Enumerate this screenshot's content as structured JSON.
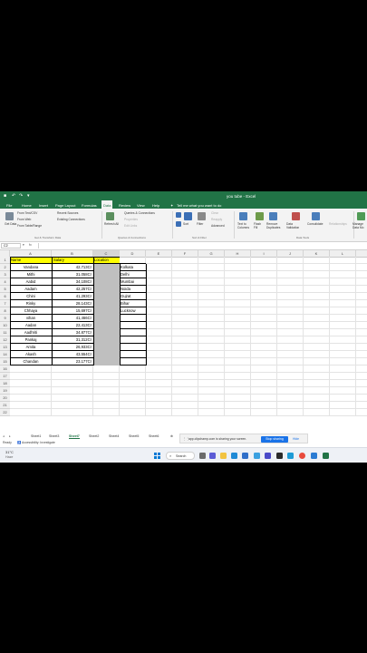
{
  "window": {
    "title": "you tube - Excel"
  },
  "menu": {
    "tabs": [
      "File",
      "Home",
      "Insert",
      "Page Layout",
      "Formulas",
      "Data",
      "Review",
      "View",
      "Help"
    ],
    "active_tab": "Data",
    "tell_me": "Tell me what you want to do"
  },
  "ribbon": {
    "get_data": "Get Data",
    "from_text": "From Text/CSV",
    "from_web": "From Web",
    "from_table": "From Table/Range",
    "recent_sources": "Recent Sources",
    "existing_connections": "Existing Connections",
    "refresh_all": "Refresh All",
    "queries_connections": "Queries & Connections",
    "properties": "Properties",
    "edit_links": "Edit Links",
    "sort": "Sort",
    "filter": "Filter",
    "clear": "Clear",
    "reapply": "Reapply",
    "advanced": "Advanced",
    "text_to_columns": "Text to Columns",
    "flash_fill": "Flash Fill",
    "remove_duplicates": "Remove Duplicates",
    "data_validation": "Data Validation",
    "consolidate": "Consolidate",
    "relationships": "Relationships",
    "manage_data_model": "Manage Data Mo",
    "group_get": "Get & Transform Data",
    "group_queries": "Queries & Connections",
    "group_sort": "Sort & Filter",
    "group_tools": "Data Tools"
  },
  "formula_bar": {
    "name_box": "C2",
    "fx": "fx"
  },
  "columns": [
    "A",
    "B",
    "C",
    "D",
    "E",
    "F",
    "G",
    "H",
    "I",
    "J",
    "K",
    "L"
  ],
  "rows": [
    "1",
    "2",
    "3",
    "4",
    "5",
    "6",
    "7",
    "8",
    "9",
    "10",
    "11",
    "12",
    "13",
    "14",
    "15",
    "16",
    "17",
    "18",
    "19",
    "20",
    "21",
    "22"
  ],
  "headers": {
    "name": "Name",
    "salary": "Salary",
    "location": "Location"
  },
  "table": [
    {
      "name": "Vandana",
      "salary": "42,713Cr",
      "location": "Kolkata"
    },
    {
      "name": "Mithi",
      "salary": "31,058Cr",
      "location": "Delhi"
    },
    {
      "name": "Aabid",
      "salary": "34,108Cr",
      "location": "Mumbai"
    },
    {
      "name": "Aadam",
      "salary": "42,257Cr",
      "location": "Noida"
    },
    {
      "name": "Chini",
      "salary": "41,293Cr",
      "location": "Gujrat"
    },
    {
      "name": "Rinky",
      "salary": "28,143Cr",
      "location": "Bihar"
    },
    {
      "name": "Chhaya",
      "salary": "15,697Cr",
      "location": "Lucknow"
    },
    {
      "name": "vihan",
      "salary": "41,466Cr",
      "location": ""
    },
    {
      "name": "Aadan",
      "salary": "22,413Cr",
      "location": ""
    },
    {
      "name": "Aadhriti",
      "salary": "34,877Cr",
      "location": ""
    },
    {
      "name": "Pankaj",
      "salary": "31,312Cr",
      "location": ""
    },
    {
      "name": "Amita",
      "salary": "26,933Cr",
      "location": ""
    },
    {
      "name": "Akash",
      "salary": "43,554Cr",
      "location": ""
    },
    {
      "name": "Chandan",
      "salary": "23,177Cr",
      "location": ""
    }
  ],
  "sheets": [
    "Sheet1",
    "Sheet3",
    "Sheet7",
    "Sheet2",
    "Sheet4",
    "Sheet5",
    "Sheet6"
  ],
  "active_sheet": "Sheet7",
  "sharing": {
    "message": "app.clipchamp.com is sharing your screen.",
    "stop": "Stop sharing",
    "hide": "Hide"
  },
  "status": {
    "ready": "Ready",
    "accessibility": "Accessibility: Investigate"
  },
  "taskbar": {
    "weather_temp": "31°C",
    "weather_text": "Haze",
    "search": "Search"
  },
  "colors": {
    "excel_green": "#217346",
    "header_yellow": "#ffff00",
    "selection_gray": "#bfbfbf",
    "share_blue": "#1a73e8"
  }
}
